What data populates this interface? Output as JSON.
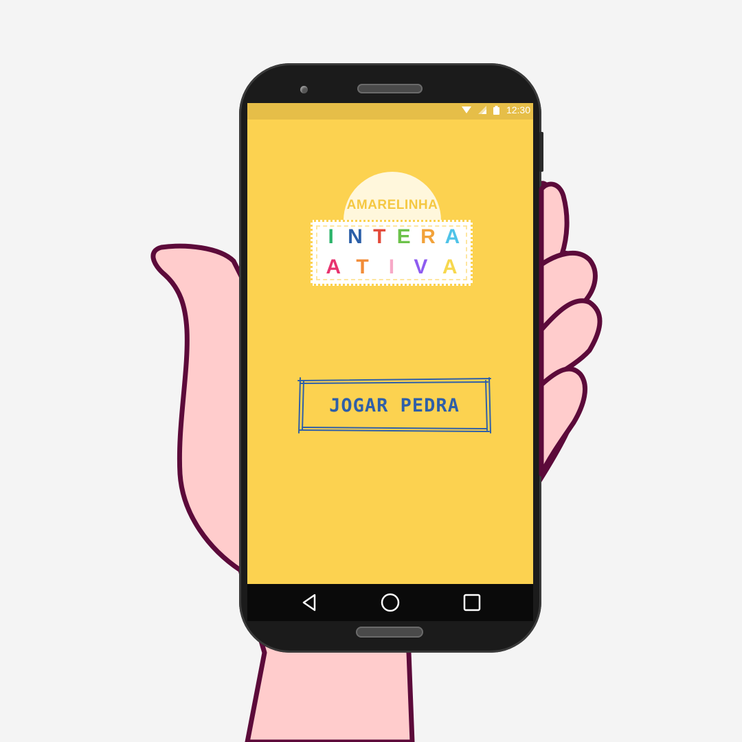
{
  "status_bar": {
    "time": "12:30",
    "icons": [
      "wifi-icon",
      "signal-icon",
      "battery-icon"
    ]
  },
  "logo": {
    "top_text": "AMARELINHA",
    "row1": [
      {
        "char": "I",
        "color": "#2bb36a"
      },
      {
        "char": "N",
        "color": "#2b5fa8"
      },
      {
        "char": "T",
        "color": "#e34a3a"
      },
      {
        "char": "E",
        "color": "#6cc24a"
      },
      {
        "char": "R",
        "color": "#f2a23a"
      },
      {
        "char": "A",
        "color": "#4fc3e8"
      }
    ],
    "row2": [
      {
        "char": "A",
        "color": "#e8336f"
      },
      {
        "char": "T",
        "color": "#f28c38"
      },
      {
        "char": "I",
        "color": "#f7a9c7"
      },
      {
        "char": "V",
        "color": "#8e5cf0"
      },
      {
        "char": "A",
        "color": "#f7d84e"
      }
    ]
  },
  "main": {
    "play_button_label": "JOGAR PEDRA"
  },
  "nav": {
    "items": [
      "back-icon",
      "home-icon",
      "recent-apps-icon"
    ]
  },
  "colors": {
    "screen": "#fcd250",
    "button_ink": "#2f5fa8",
    "hand_fill": "#ffcccc",
    "hand_outline": "#5c0a3a"
  }
}
